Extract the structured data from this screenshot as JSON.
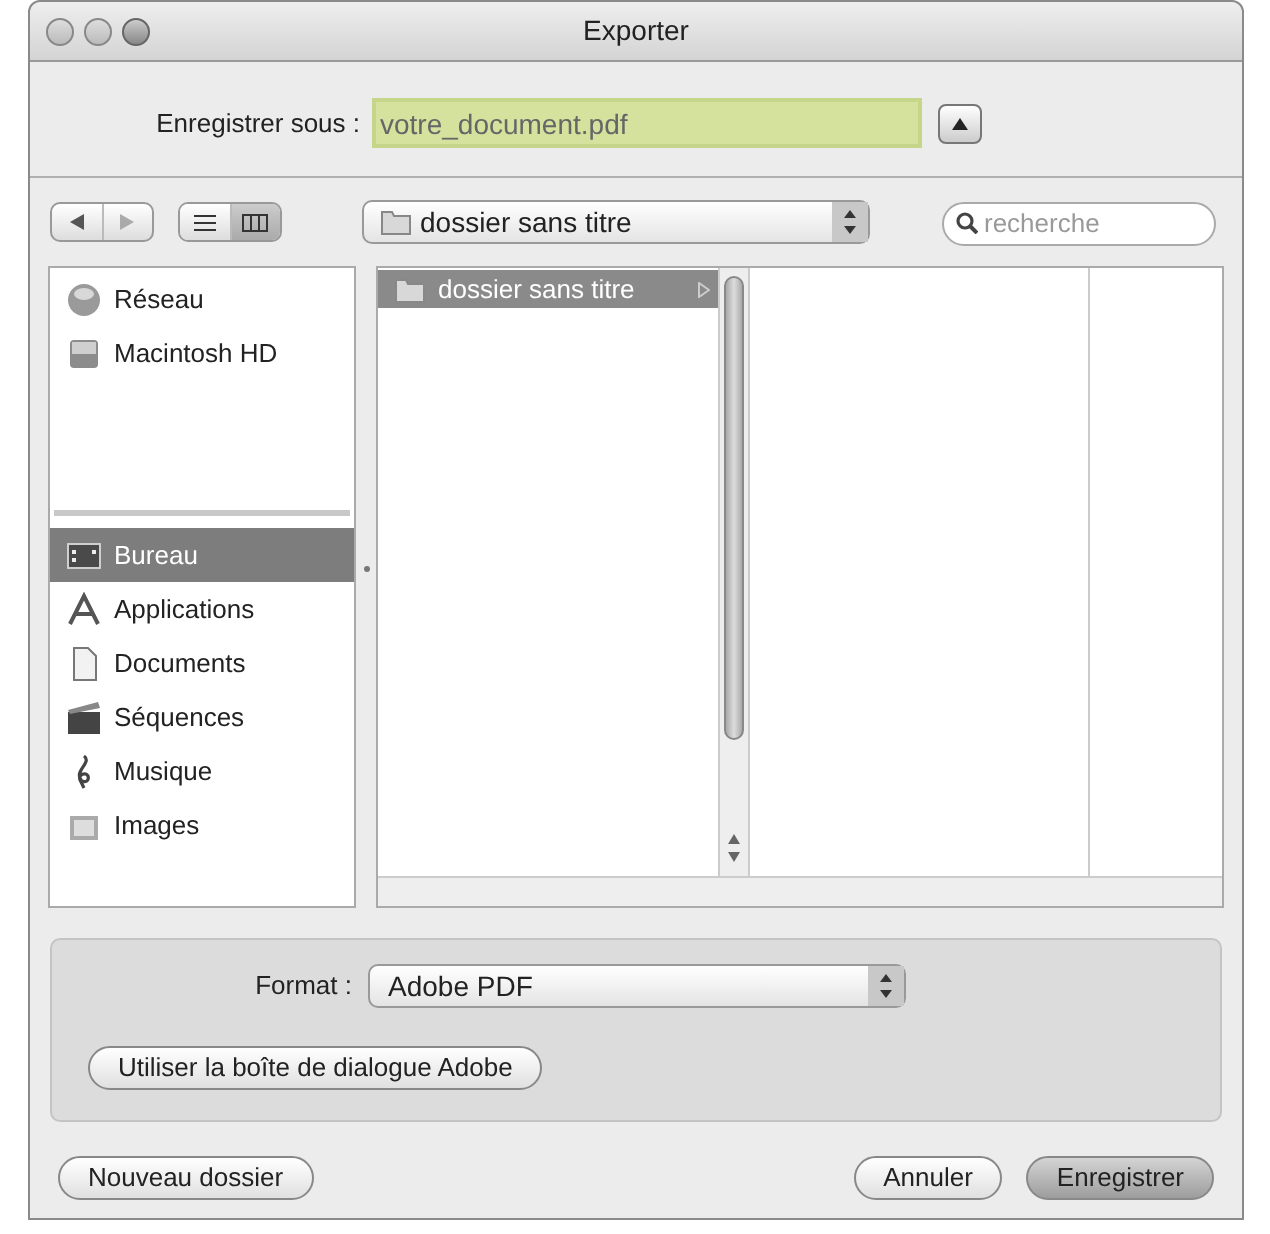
{
  "window": {
    "title": "Exporter"
  },
  "save_as": {
    "label": "Enregistrer sous :",
    "value": "votre_document.pdf",
    "expanded": false
  },
  "toolbar": {
    "view_buttons": [
      {
        "kind": "list",
        "selected": false
      },
      {
        "kind": "columns",
        "selected": true
      }
    ],
    "path": "dossier sans titre",
    "search": {
      "placeholder": "recherche"
    }
  },
  "sidebar": {
    "devices": [
      {
        "kind": "network",
        "label": "Réseau",
        "selected": false
      },
      {
        "kind": "disk",
        "label": "Macintosh HD",
        "selected": false
      }
    ],
    "places": [
      {
        "kind": "desktop",
        "label": "Bureau",
        "selected": true
      },
      {
        "kind": "apps",
        "label": "Applications",
        "selected": false
      },
      {
        "kind": "documents",
        "label": "Documents",
        "selected": false
      },
      {
        "kind": "movies",
        "label": "Séquences",
        "selected": false
      },
      {
        "kind": "music",
        "label": "Musique",
        "selected": false
      },
      {
        "kind": "pictures",
        "label": "Images",
        "selected": false
      }
    ]
  },
  "browser": {
    "columns": [
      [
        {
          "label": "dossier sans titre",
          "selected": true
        }
      ]
    ]
  },
  "format": {
    "label": "Format :",
    "value": "Adobe PDF"
  },
  "adobe_button": "Utiliser la boîte de dialogue Adobe",
  "buttons": [
    {
      "label": "Nouveau dossier",
      "kind": "plain"
    },
    {
      "label": "Annuler",
      "kind": "plain"
    },
    {
      "label": "Enregistrer",
      "kind": "default"
    }
  ]
}
